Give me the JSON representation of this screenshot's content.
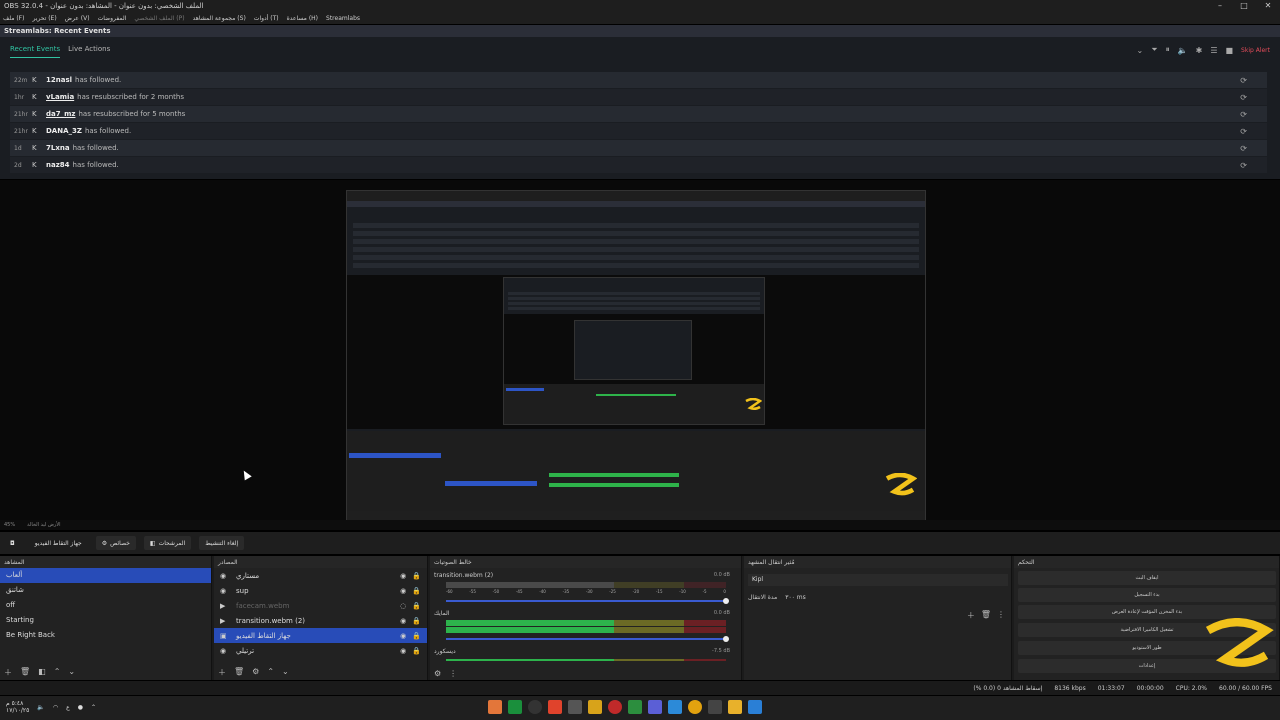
{
  "window": {
    "title": "OBS 32.0.4 - الملف الشخصي: بدون عنوان - المشاهد: بدون عنوان",
    "minimize": "–",
    "maximize": "□",
    "close": "✕"
  },
  "menu": [
    "ملف (F)",
    "تحرير (E)",
    "عرض (V)",
    "المفروضات",
    "الملف الشخصي (P)",
    "مجموعة المشاهد (S)",
    "أدوات (T)",
    "مساعدة (H)",
    "Streamlabs"
  ],
  "dock": {
    "title": "Streamlabs: Recent Events"
  },
  "events": {
    "tabs": [
      "Recent Events",
      "Live Actions"
    ],
    "skip_label": "Skip Alert",
    "rows": [
      {
        "time": "22m",
        "user": "12nasl",
        "text": "has followed."
      },
      {
        "time": "1hr",
        "user": "vLamia",
        "text": "has resubscribed for 2 months"
      },
      {
        "time": "21hr",
        "user": "da7_mz",
        "text": "has resubscribed for 5 months"
      },
      {
        "time": "21hr",
        "user": "DANA_3Z",
        "text": "has followed."
      },
      {
        "time": "1d",
        "user": "7Lxna",
        "text": "has followed."
      },
      {
        "time": "2d",
        "user": "naz84",
        "text": "has followed."
      }
    ]
  },
  "preview_status": {
    "zoom": "45%",
    "label": "الأرض ليد الخالة"
  },
  "toolbar": {
    "studio_mode": "جهاز التقاط الفيديو",
    "settings": "خصائص",
    "filters": "المرشحات",
    "deactivate": "إلغاء التنشيط"
  },
  "scenes": {
    "header": "المشاهد",
    "items": [
      "ألعاب",
      "شاتنق",
      "off",
      "Starting",
      "Be Right Back"
    ]
  },
  "sources": {
    "header": "المصادر",
    "items": [
      {
        "name": "مستاري",
        "icon": "◉",
        "active": false,
        "dim": false
      },
      {
        "name": "sup",
        "icon": "◉",
        "active": false,
        "dim": false
      },
      {
        "name": "facecam.webm",
        "icon": "▶",
        "active": false,
        "dim": true
      },
      {
        "name": "transition.webm (2)",
        "icon": "▶",
        "active": false,
        "dim": false
      },
      {
        "name": "جهاز التقاط الفيديو",
        "icon": "▣",
        "active": true,
        "dim": false
      },
      {
        "name": "ترتيلي",
        "icon": "◉",
        "active": false,
        "dim": false
      }
    ]
  },
  "mixer": {
    "header": "خالط الصوتيات",
    "ch1": {
      "name": "transition.webm (2)",
      "db": "0.0 dB"
    },
    "ch2": {
      "name": "المايك",
      "db": "0.0 dB"
    },
    "ch3": {
      "name": "ديسكورد",
      "db": "-7.5 dB"
    },
    "ticks": [
      "-60",
      "-55",
      "-50",
      "-45",
      "-40",
      "-35",
      "-30",
      "-25",
      "-20",
      "-15",
      "-10",
      "-5",
      "0"
    ]
  },
  "transitions": {
    "header": "مُثير انتقال المشهد",
    "selected": "Kipl",
    "duration_label": "مدة الانتقال",
    "duration": "٣٠٠ ms"
  },
  "controls": {
    "header": "التحكم",
    "buttons": [
      "ايقاف البث",
      "بدء التسجيل",
      "بدء المخزن المؤقت لإعادة العرض",
      "تشغيل الكاميرا الافتراضية",
      "طور الاستوديو",
      "إعدادات"
    ]
  },
  "status": {
    "dropped": "إسقاط المشاهد 0 (0.0 %)",
    "bitrate": "8136 kbps",
    "live": "01:33:07",
    "rec": "00:00:00",
    "cpu": "CPU: 2.0%",
    "fps": "60.00 / 60.00 FPS"
  },
  "taskbar": {
    "time": "٥:٤٨ م",
    "date": "١٧/١٠/٢٥",
    "lang": "ع"
  }
}
